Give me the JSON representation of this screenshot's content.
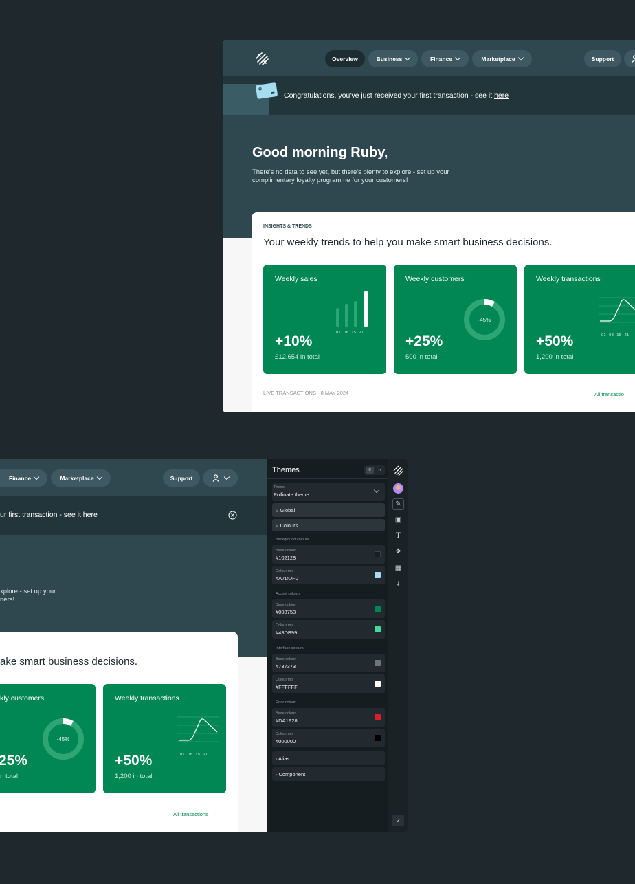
{
  "nav": {
    "overview": "Overview",
    "business": "Business",
    "finance": "Finance",
    "marketplace": "Marketplace",
    "support": "Support"
  },
  "banner": {
    "text": "Congratulations, you've just received your first transaction - see it ",
    "text_cut": "ur first transaction - see it ",
    "link": "here"
  },
  "hero": {
    "greeting": "Good morning Ruby,",
    "line1": "There's no data to see yet, but there's plenty to explore - set up your",
    "line2": "complimentary loyalty programme for your customers!",
    "line1_cut": "xplore - set up your",
    "line2_cut": "ners!"
  },
  "insights": {
    "eyebrow": "INSIGHTS & TRENDS",
    "heading": "Your weekly trends to help you make smart business decisions.",
    "heading_cut": "ake smart business decisions.",
    "tiles": [
      {
        "title": "Weekly sales",
        "value": "+10%",
        "sub": "£12,654 in total",
        "ticks": [
          "01",
          "08",
          "15",
          "21"
        ]
      },
      {
        "title": "Weekly customers",
        "title_cut": "kly customers",
        "value": "+25%",
        "value_cut": "25%",
        "sub": "500 in total",
        "sub_cut": "in total",
        "donut_label": "-45%"
      },
      {
        "title": "Weekly transactions",
        "value": "+50%",
        "sub": "1,200 in total",
        "ticks": [
          "01",
          "08",
          "15",
          "21"
        ]
      }
    ],
    "live": "LIVE TRANSACTIONS - 8 MAY 2024",
    "all_link": "All transactions",
    "all_link_cut": "All transactio"
  },
  "panel": {
    "title": "Themes",
    "theme_caption": "Theme",
    "theme_value": "Pollinate theme",
    "global": "Global",
    "colours": "Colours",
    "groups": [
      {
        "label": "Background colours",
        "items": [
          {
            "caption": "Base colour",
            "value": "#102128",
            "color": "#102128"
          },
          {
            "caption": "Colour mix",
            "value": "#A7DDF0",
            "color": "#A7DDF0"
          }
        ]
      },
      {
        "label": "Accent colours",
        "items": [
          {
            "caption": "Base colour",
            "value": "#008753",
            "color": "#008753"
          },
          {
            "caption": "Colour mix",
            "value": "#43DB99",
            "color": "#43DB99"
          }
        ]
      },
      {
        "label": "Interface colours",
        "items": [
          {
            "caption": "Base colour",
            "value": "#737373",
            "color": "#737373"
          },
          {
            "caption": "Colour mix",
            "value": "#FFFFFF",
            "color": "#FFFFFF"
          }
        ]
      },
      {
        "label": "Error colour",
        "items": [
          {
            "caption": "Base colour",
            "value": "#DA1F28",
            "color": "#DA1F28"
          },
          {
            "caption": "Colour mix",
            "value": "#000000",
            "color": "#000000"
          }
        ]
      }
    ],
    "alias": "Alias",
    "component": "Component"
  },
  "icons": {
    "logo": "logo-icon",
    "user": "user-icon",
    "close": "close-circle-icon",
    "card": "card-icon",
    "arrow": "arrow-right-icon"
  }
}
